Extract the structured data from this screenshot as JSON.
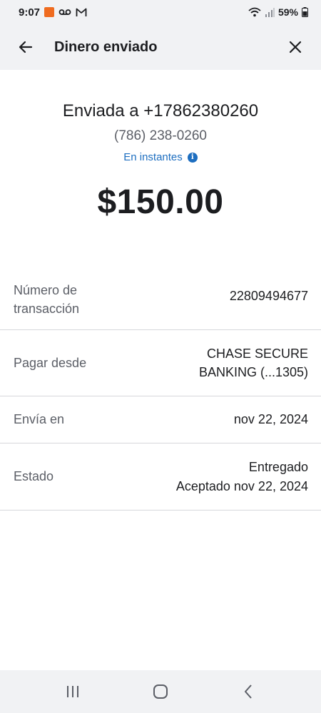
{
  "status_bar": {
    "time": "9:07",
    "battery": "59%",
    "icons": [
      "app-notification-icon",
      "voicemail-icon",
      "gmail-icon",
      "wifi-icon",
      "signal-icon",
      "battery-icon"
    ]
  },
  "app_bar": {
    "title": "Dinero enviado",
    "back_icon": "arrow-left-icon",
    "close_icon": "close-icon"
  },
  "summary": {
    "sent_to": "Enviada a +17862380260",
    "phone": "(786) 238-0260",
    "speed": "En instantes",
    "amount": "$150.00"
  },
  "details": [
    {
      "label": "Número de transacción",
      "value": "22809494677"
    },
    {
      "label": "Pagar desde",
      "value_line1": "CHASE SECURE",
      "value_line2": "BANKING (...1305)"
    },
    {
      "label": "Envía en",
      "value": "nov 22, 2024"
    },
    {
      "label": "Estado",
      "value_line1": "Entregado",
      "value_line2": "Aceptado nov 22, 2024"
    }
  ],
  "nav_bar": {
    "icons": [
      "recent-apps-icon",
      "home-icon",
      "back-icon"
    ]
  },
  "colors": {
    "accent": "#1d6ec0",
    "text": "#1c1d20",
    "muted": "#5b5e66",
    "bar_bg": "#f1f2f4",
    "divider": "#d6d7db"
  }
}
